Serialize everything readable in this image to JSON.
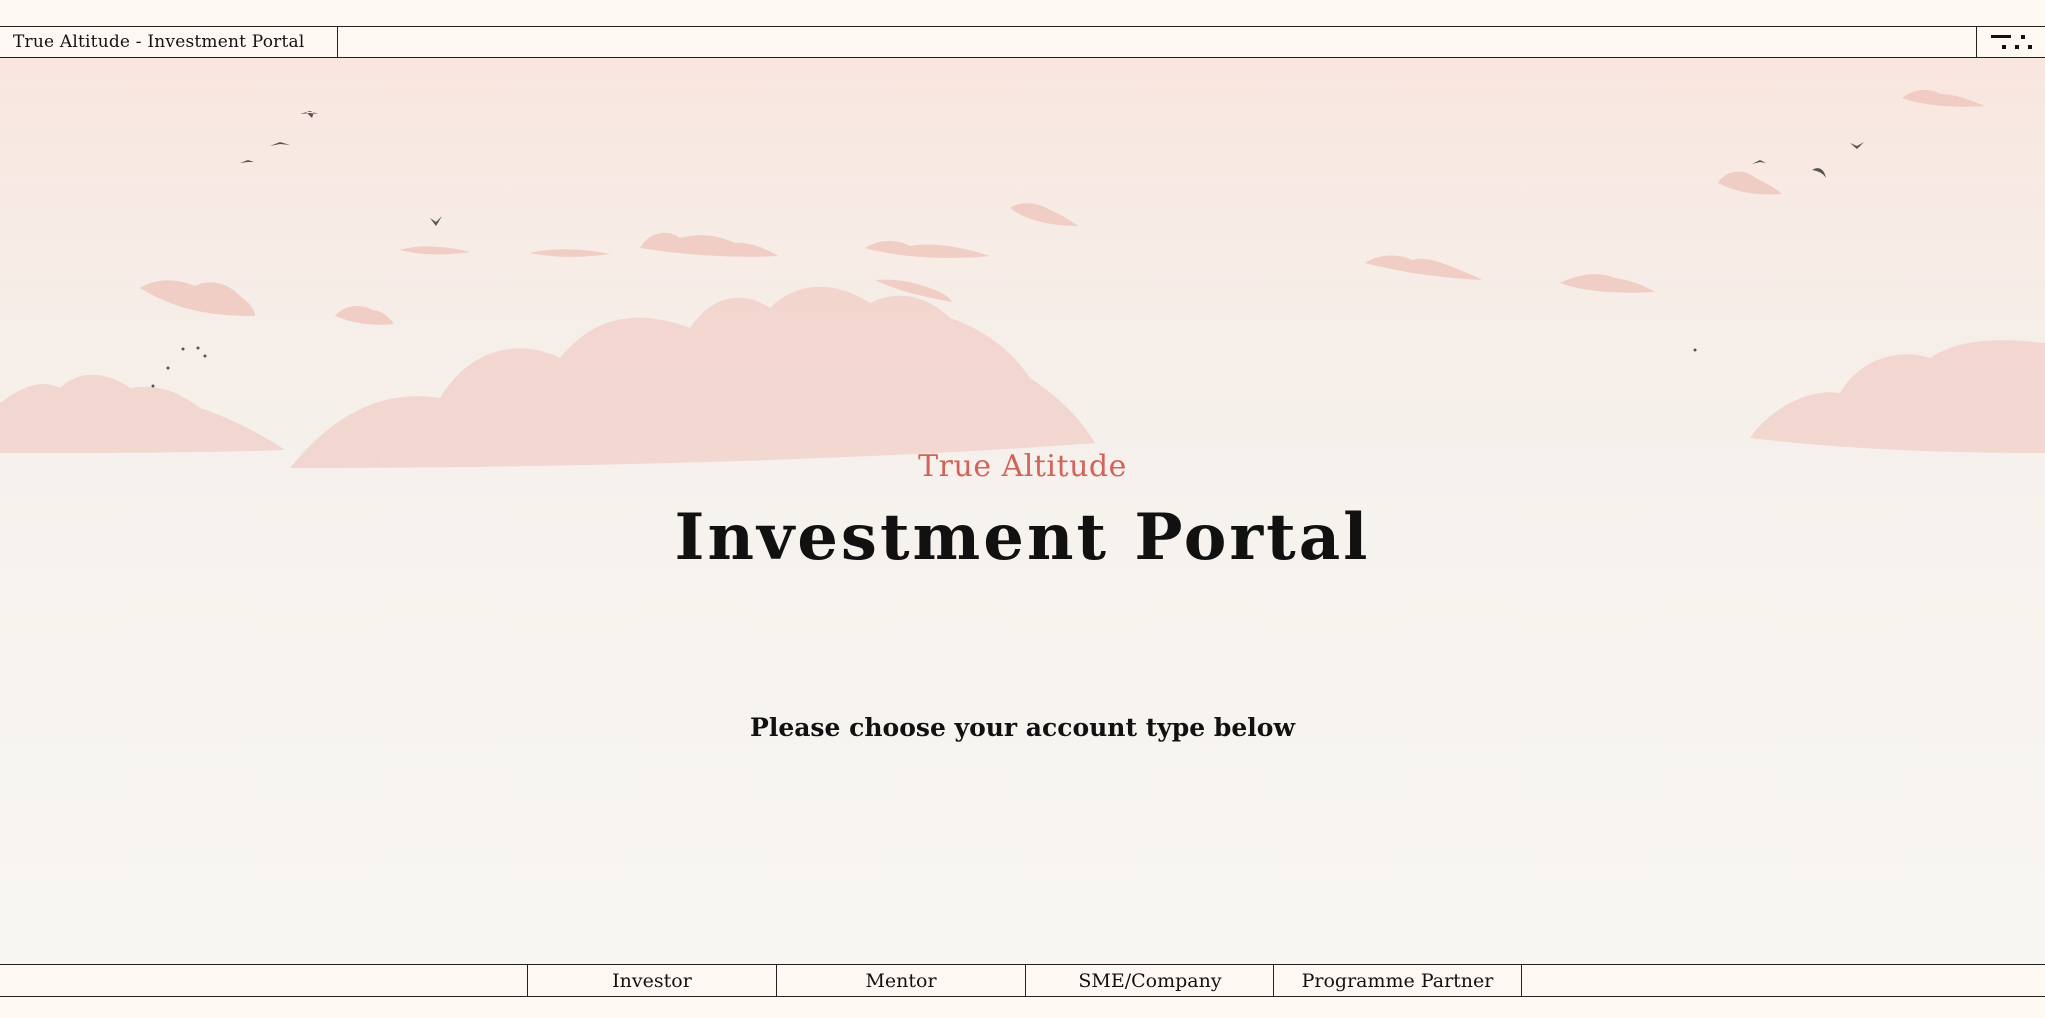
{
  "header": {
    "brand": "True Altitude - Investment Portal",
    "menu_icon": "menu-dots-icon"
  },
  "hero": {
    "kicker": "True Altitude",
    "title": "Investment Portal",
    "subtitle": "Please choose your account type below"
  },
  "account_tabs": [
    {
      "label": "Investor"
    },
    {
      "label": "Mentor"
    },
    {
      "label": "SME/Company"
    },
    {
      "label": "Programme Partner"
    }
  ],
  "colors": {
    "page_background": "#fdf9f2",
    "accent": "#d2625a",
    "text": "#111111",
    "cloud": "#f0c9c0"
  }
}
